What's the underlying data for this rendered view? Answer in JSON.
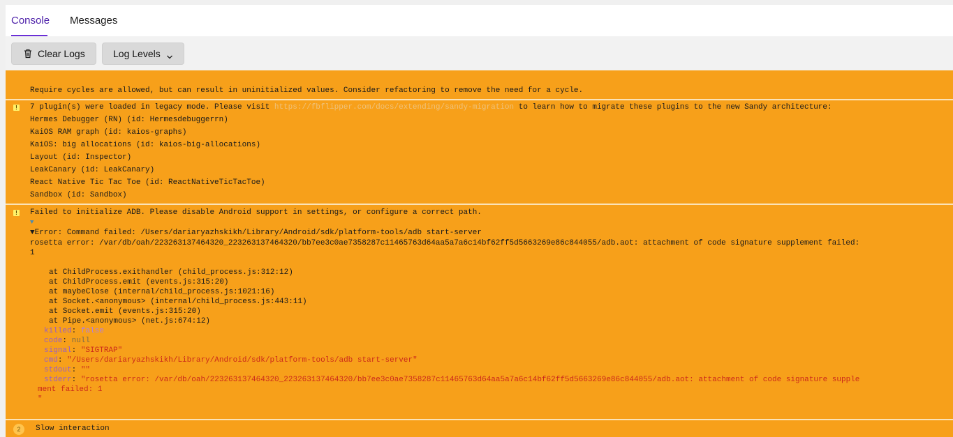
{
  "tabs": [
    {
      "label": "Console",
      "active": true
    },
    {
      "label": "Messages",
      "active": false
    }
  ],
  "toolbar": {
    "clear_label": "Clear Logs",
    "levels_label": "Log Levels"
  },
  "colors": {
    "accent": "#6a2fd6",
    "warning_bg": "#f7a01a",
    "toolbar_bg": "#f2f2f2"
  },
  "log": {
    "entry1": {
      "text": "Require cycles are allowed, but can result in uninitialized values. Consider refactoring to remove the need for a cycle."
    },
    "entry2": {
      "intro_before": "7 plugin(s) were loaded in legacy mode. Please visit ",
      "link": "https://fbflipper.com/docs/extending/sandy-migration",
      "intro_after": " to learn how to migrate these plugins to the new Sandy architecture:",
      "plugins": [
        "Hermes Debugger (RN) (id: Hermesdebuggerrn)",
        "KaiOS RAM graph (id: kaios-graphs)",
        "KaiOS: big allocations (id: kaios-big-allocations)",
        "Layout (id: Inspector)",
        "LeakCanary (id: LeakCanary)",
        "React Native Tic Tac Toe (id: ReactNativeTicTacToe)",
        "Sandbox (id: Sandbox)"
      ]
    },
    "entry3": {
      "title": "Failed to initialize ADB. Please disable Android support in settings, or configure a correct path.",
      "error_line": "Error: Command failed: /Users/dariaryazhskikh/Library/Android/sdk/platform-tools/adb start-server",
      "rosetta_line1": "rosetta error: /var/db/oah/223263137464320_223263137464320/bb7ee3c0ae7358287c11465763d64aa5a7a6c14bf62ff5d5663269e86c844055/adb.aot: attachment of code signature supplement failed:",
      "rosetta_line2": "1",
      "stack": [
        "at ChildProcess.exithandler (child_process.js:312:12)",
        "at ChildProcess.emit (events.js:315:20)",
        "at maybeClose (internal/child_process.js:1021:16)",
        "at Socket.<anonymous> (internal/child_process.js:443:11)",
        "at Socket.emit (events.js:315:20)",
        "at Pipe.<anonymous> (net.js:674:12)"
      ],
      "props": {
        "killed_key": "killed",
        "killed_val": "false",
        "code_key": "code",
        "code_val": "null",
        "signal_key": "signal",
        "signal_val": "\"SIGTRAP\"",
        "cmd_key": "cmd",
        "cmd_val": "\"/Users/dariaryazhskikh/Library/Android/sdk/platform-tools/adb start-server\"",
        "stdout_key": "stdout",
        "stdout_val": "\"\"",
        "stderr_key": "stderr",
        "stderr_val1": "\"rosetta error: /var/db/oah/223263137464320_223263137464320/bb7ee3c0ae7358287c11465763d64aa5a7a6c14bf62ff5d5663269e86c844055/adb.aot: attachment of code signature supple",
        "stderr_val2": "ment failed: 1",
        "stderr_val3": "\""
      }
    },
    "entry4": {
      "count": "2",
      "text": "Slow interaction"
    }
  }
}
